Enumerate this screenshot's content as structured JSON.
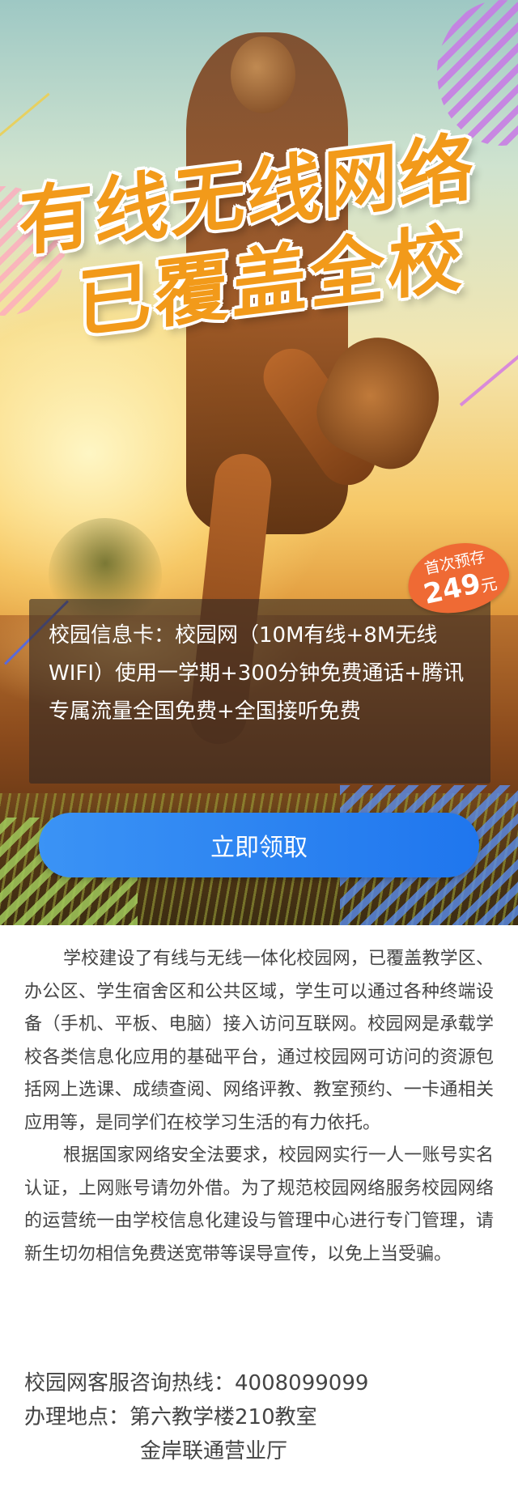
{
  "hero": {
    "headline_line1": "有线无线网络",
    "headline_line2": "已覆盖全校",
    "badge": {
      "top": "首次预存",
      "price": "249",
      "unit": "元"
    },
    "info": "校园信息卡：校园网（10M有线+8M无线WIFI）使用一学期+300分钟免费通话+腾讯专属流量全国免费+全国接听免费",
    "cta_label": "立即领取",
    "colors": {
      "headline": "#f29a1a",
      "badge": "#ef6a34",
      "cta": "#1f76ee"
    }
  },
  "content": {
    "paragraph1": "学校建设了有线与无线一体化校园网，已覆盖教学区、办公区、学生宿舍区和公共区域，学生可以通过各种终端设备（手机、平板、电脑）接入访问互联网。校园网是承载学校各类信息化应用的基础平台，通过校园网可访问的资源包括网上选课、成绩查阅、网络评教、教室预约、一卡通相关应用等，是同学们在校学习生活的有力依托。",
    "paragraph2": "根据国家网络安全法要求，校园网实行一人一账号实名认证，上网账号请勿外借。为了规范校园网络服务校园网络的运营统一由学校信息化建设与管理中心进行专门管理，请新生切勿相信免费送宽带等误导宣传，以免上当受骗。"
  },
  "contact": {
    "hotline": "校园网客服咨询热线：4008099099",
    "location": "办理地点：第六教学楼210教室",
    "location2": "金岸联通营业厅"
  }
}
